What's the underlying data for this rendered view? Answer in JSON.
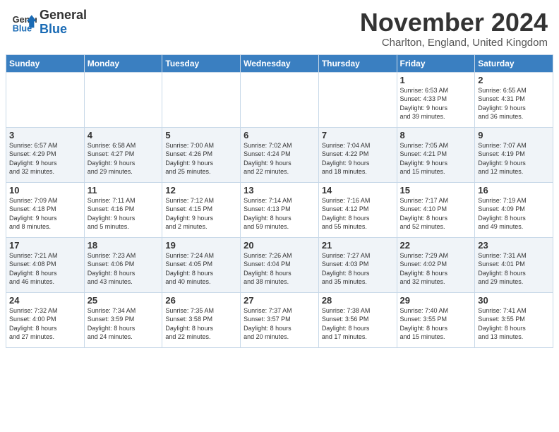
{
  "header": {
    "logo_general": "General",
    "logo_blue": "Blue",
    "month_title": "November 2024",
    "location": "Charlton, England, United Kingdom"
  },
  "days_of_week": [
    "Sunday",
    "Monday",
    "Tuesday",
    "Wednesday",
    "Thursday",
    "Friday",
    "Saturday"
  ],
  "weeks": [
    [
      {
        "day": "",
        "info": ""
      },
      {
        "day": "",
        "info": ""
      },
      {
        "day": "",
        "info": ""
      },
      {
        "day": "",
        "info": ""
      },
      {
        "day": "",
        "info": ""
      },
      {
        "day": "1",
        "info": "Sunrise: 6:53 AM\nSunset: 4:33 PM\nDaylight: 9 hours\nand 39 minutes."
      },
      {
        "day": "2",
        "info": "Sunrise: 6:55 AM\nSunset: 4:31 PM\nDaylight: 9 hours\nand 36 minutes."
      }
    ],
    [
      {
        "day": "3",
        "info": "Sunrise: 6:57 AM\nSunset: 4:29 PM\nDaylight: 9 hours\nand 32 minutes."
      },
      {
        "day": "4",
        "info": "Sunrise: 6:58 AM\nSunset: 4:27 PM\nDaylight: 9 hours\nand 29 minutes."
      },
      {
        "day": "5",
        "info": "Sunrise: 7:00 AM\nSunset: 4:26 PM\nDaylight: 9 hours\nand 25 minutes."
      },
      {
        "day": "6",
        "info": "Sunrise: 7:02 AM\nSunset: 4:24 PM\nDaylight: 9 hours\nand 22 minutes."
      },
      {
        "day": "7",
        "info": "Sunrise: 7:04 AM\nSunset: 4:22 PM\nDaylight: 9 hours\nand 18 minutes."
      },
      {
        "day": "8",
        "info": "Sunrise: 7:05 AM\nSunset: 4:21 PM\nDaylight: 9 hours\nand 15 minutes."
      },
      {
        "day": "9",
        "info": "Sunrise: 7:07 AM\nSunset: 4:19 PM\nDaylight: 9 hours\nand 12 minutes."
      }
    ],
    [
      {
        "day": "10",
        "info": "Sunrise: 7:09 AM\nSunset: 4:18 PM\nDaylight: 9 hours\nand 8 minutes."
      },
      {
        "day": "11",
        "info": "Sunrise: 7:11 AM\nSunset: 4:16 PM\nDaylight: 9 hours\nand 5 minutes."
      },
      {
        "day": "12",
        "info": "Sunrise: 7:12 AM\nSunset: 4:15 PM\nDaylight: 9 hours\nand 2 minutes."
      },
      {
        "day": "13",
        "info": "Sunrise: 7:14 AM\nSunset: 4:13 PM\nDaylight: 8 hours\nand 59 minutes."
      },
      {
        "day": "14",
        "info": "Sunrise: 7:16 AM\nSunset: 4:12 PM\nDaylight: 8 hours\nand 55 minutes."
      },
      {
        "day": "15",
        "info": "Sunrise: 7:17 AM\nSunset: 4:10 PM\nDaylight: 8 hours\nand 52 minutes."
      },
      {
        "day": "16",
        "info": "Sunrise: 7:19 AM\nSunset: 4:09 PM\nDaylight: 8 hours\nand 49 minutes."
      }
    ],
    [
      {
        "day": "17",
        "info": "Sunrise: 7:21 AM\nSunset: 4:08 PM\nDaylight: 8 hours\nand 46 minutes."
      },
      {
        "day": "18",
        "info": "Sunrise: 7:23 AM\nSunset: 4:06 PM\nDaylight: 8 hours\nand 43 minutes."
      },
      {
        "day": "19",
        "info": "Sunrise: 7:24 AM\nSunset: 4:05 PM\nDaylight: 8 hours\nand 40 minutes."
      },
      {
        "day": "20",
        "info": "Sunrise: 7:26 AM\nSunset: 4:04 PM\nDaylight: 8 hours\nand 38 minutes."
      },
      {
        "day": "21",
        "info": "Sunrise: 7:27 AM\nSunset: 4:03 PM\nDaylight: 8 hours\nand 35 minutes."
      },
      {
        "day": "22",
        "info": "Sunrise: 7:29 AM\nSunset: 4:02 PM\nDaylight: 8 hours\nand 32 minutes."
      },
      {
        "day": "23",
        "info": "Sunrise: 7:31 AM\nSunset: 4:01 PM\nDaylight: 8 hours\nand 29 minutes."
      }
    ],
    [
      {
        "day": "24",
        "info": "Sunrise: 7:32 AM\nSunset: 4:00 PM\nDaylight: 8 hours\nand 27 minutes."
      },
      {
        "day": "25",
        "info": "Sunrise: 7:34 AM\nSunset: 3:59 PM\nDaylight: 8 hours\nand 24 minutes."
      },
      {
        "day": "26",
        "info": "Sunrise: 7:35 AM\nSunset: 3:58 PM\nDaylight: 8 hours\nand 22 minutes."
      },
      {
        "day": "27",
        "info": "Sunrise: 7:37 AM\nSunset: 3:57 PM\nDaylight: 8 hours\nand 20 minutes."
      },
      {
        "day": "28",
        "info": "Sunrise: 7:38 AM\nSunset: 3:56 PM\nDaylight: 8 hours\nand 17 minutes."
      },
      {
        "day": "29",
        "info": "Sunrise: 7:40 AM\nSunset: 3:55 PM\nDaylight: 8 hours\nand 15 minutes."
      },
      {
        "day": "30",
        "info": "Sunrise: 7:41 AM\nSunset: 3:55 PM\nDaylight: 8 hours\nand 13 minutes."
      }
    ]
  ]
}
